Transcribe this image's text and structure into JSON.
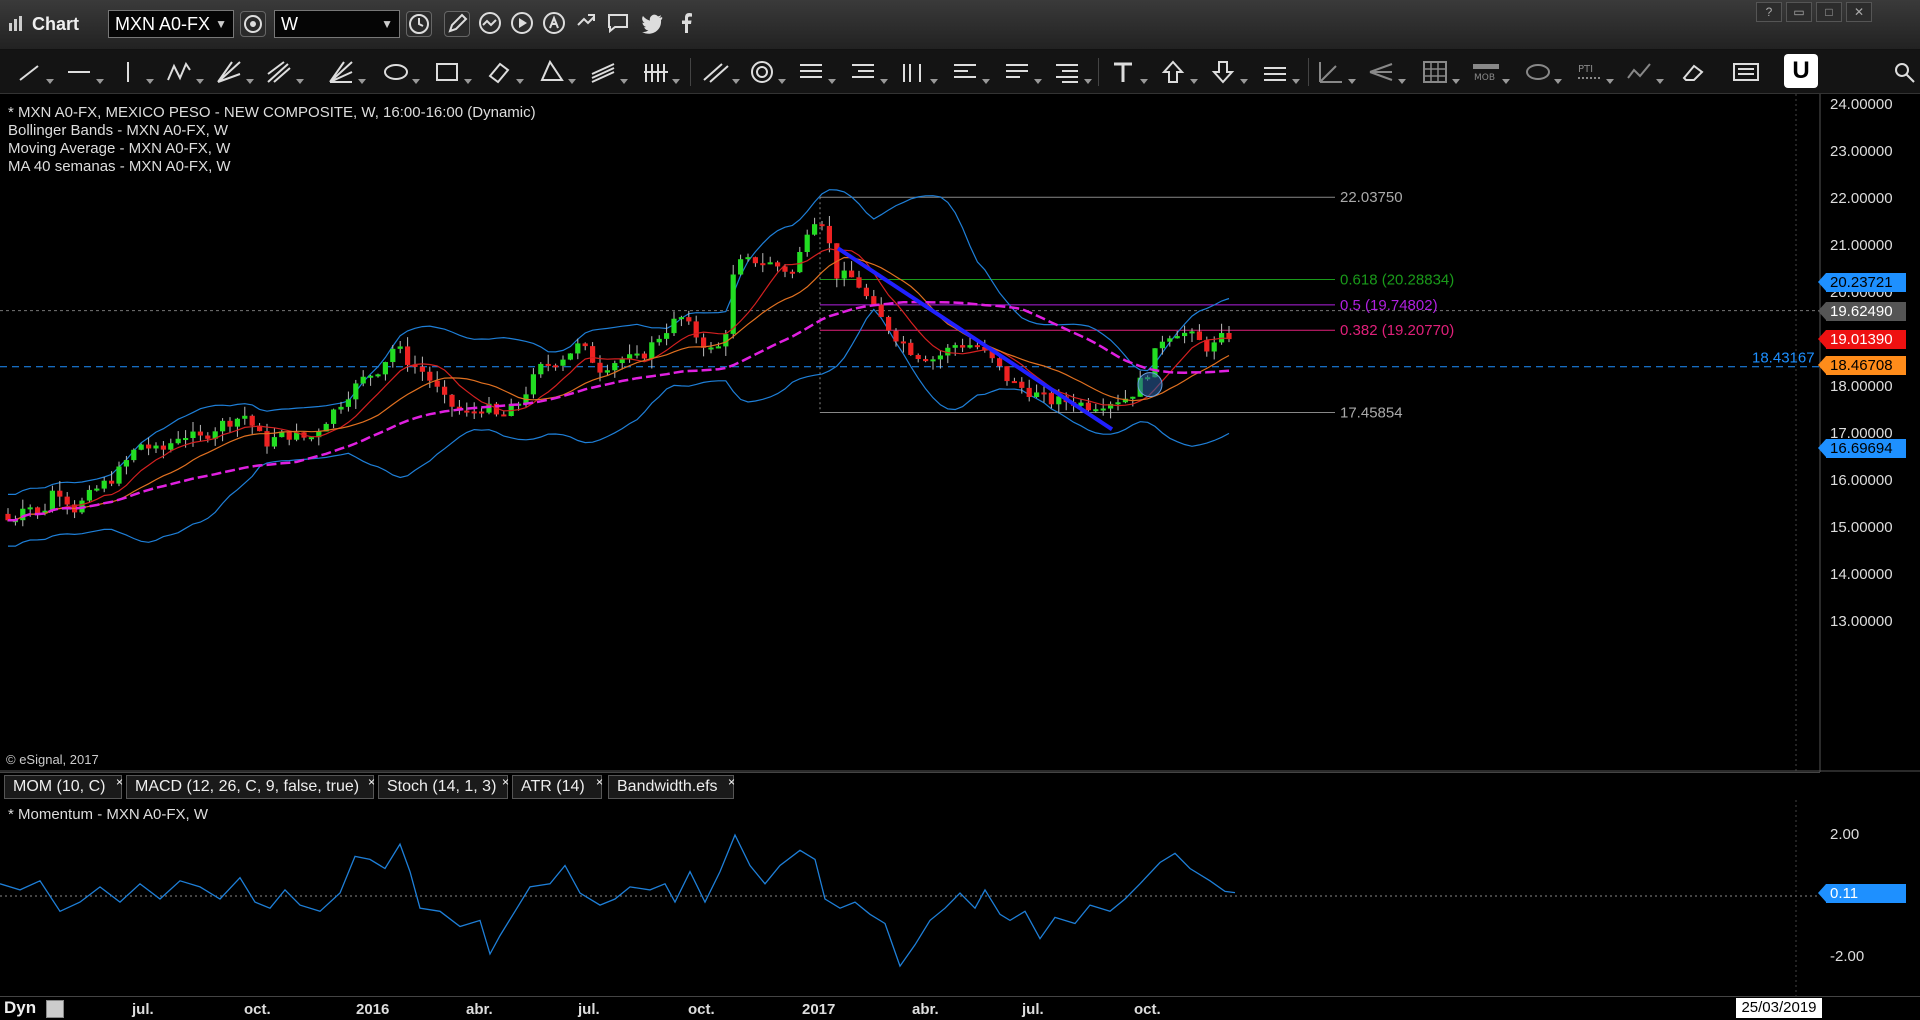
{
  "titlebar": {
    "title": "Chart",
    "symbol": "MXN A0-FX",
    "interval": "W"
  },
  "drawing_tools": [
    "line-tool",
    "horizontal-line-tool",
    "vertical-line-tool",
    "zigzag-tool",
    "gann-fan-tool",
    "fibonacci-fan-tool",
    "ellipse-tool",
    "rectangle-tool",
    "diamond-tool",
    "triangle-tool",
    "channel-tool",
    "cycle-lines-tool",
    "parallel-tool",
    "circle-tool",
    "fib-retracement-tool",
    "fib-extension-tool",
    "fib-time-tool",
    "speed-lines-tool",
    "regression-tool",
    "quadrant-tool",
    "text-tool",
    "arrow-up-tool",
    "arrow-down-tool",
    "price-line-tool",
    "angle-tool",
    "pitchfork-tool",
    "grid-tool",
    "mob-tool",
    "ellipse-alt-tool",
    "pti-tool",
    "andrews-tool",
    "eraser-tool",
    "notes-tool"
  ],
  "drawing_tool_texts": {
    "mob": "MOB",
    "pti": "PTI"
  },
  "u_button": "U",
  "legend": [
    "* MXN A0-FX, MEXICO PESO - NEW COMPOSITE, W, 16:00-16:00 (Dynamic)",
    "Bollinger Bands - MXN A0-FX, W",
    "Moving Average - MXN A0-FX, W",
    "MA 40 semanas - MXN A0-FX, W"
  ],
  "copyright": "© eSignal, 2017",
  "price_axis": {
    "ticks": [
      "24.00000",
      "23.00000",
      "22.00000",
      "21.00000",
      "20.00000",
      "18.00000",
      "17.00000",
      "16.00000",
      "15.00000",
      "14.00000",
      "13.00000"
    ],
    "tags": [
      {
        "value": "20.23721",
        "color": "#1e90ff"
      },
      {
        "value": "19.62490",
        "color": "#555555"
      },
      {
        "value": "19.01390",
        "color": "#ee1111"
      },
      {
        "value": "18.46708",
        "color": "#ff8c1a"
      },
      {
        "value": "16.69694",
        "color": "#1e90ff"
      }
    ],
    "hline_label": "18.43167"
  },
  "fib_labels": {
    "high": "22.03750",
    "f618": "0.618 (20.28834)",
    "f50": "0.5 (19.74802)",
    "f382": "0.382 (19.20770)",
    "low": "17.45854"
  },
  "colors": {
    "bull": "#22dd22",
    "bear": "#ee2222",
    "bollinger": "#1e7fd8",
    "ma_fast": "#d42020",
    "ma_mid": "#e07020",
    "ma40": "#e020e0",
    "trendline": "#2020ff",
    "fib618": "#1a9a1a",
    "fib50": "#b020e0",
    "fib382": "#e0207a"
  },
  "tabs": [
    {
      "label": "MOM (10, C)"
    },
    {
      "label": "MACD (12, 26, C, 9, false, true)"
    },
    {
      "label": "Stoch (14, 1, 3)"
    },
    {
      "label": "ATR (14)"
    },
    {
      "label": "Bandwidth.efs"
    }
  ],
  "tab_close": "×",
  "momentum": {
    "legend": "* Momentum - MXN A0-FX, W",
    "ticks": [
      "2.00",
      "-2.00"
    ],
    "tag": "0.11"
  },
  "x_axis": [
    "jul.",
    "oct.",
    "2016",
    "abr.",
    "jul.",
    "oct.",
    "2017",
    "abr.",
    "jul.",
    "oct."
  ],
  "bottom": {
    "dyn": "Dyn",
    "date": "25/03/2019"
  }
}
